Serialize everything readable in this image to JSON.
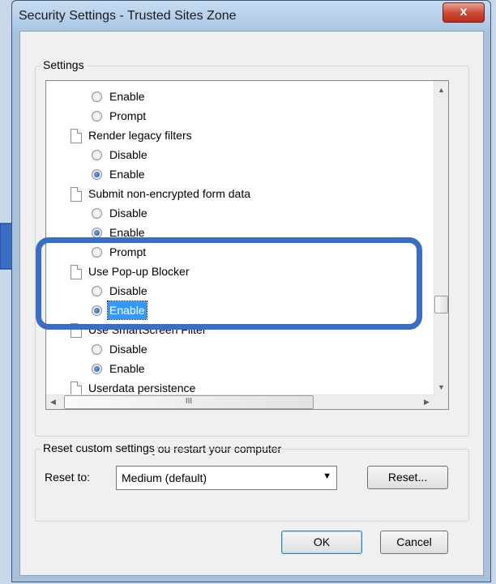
{
  "window": {
    "title": "Security Settings - Trusted Sites Zone",
    "close_label": "x"
  },
  "settings_group": {
    "label": "Settings",
    "rows": [
      {
        "kind": "radio",
        "label": "Enable",
        "checked": false
      },
      {
        "kind": "radio",
        "label": "Prompt",
        "checked": false
      },
      {
        "kind": "setting",
        "label": "Render legacy filters"
      },
      {
        "kind": "radio",
        "label": "Disable",
        "checked": false
      },
      {
        "kind": "radio",
        "label": "Enable",
        "checked": true
      },
      {
        "kind": "setting",
        "label": "Submit non-encrypted form data"
      },
      {
        "kind": "radio",
        "label": "Disable",
        "checked": false
      },
      {
        "kind": "radio",
        "label": "Enable",
        "checked": true
      },
      {
        "kind": "radio",
        "label": "Prompt",
        "checked": false
      },
      {
        "kind": "setting",
        "label": "Use Pop-up Blocker"
      },
      {
        "kind": "radio",
        "label": "Disable",
        "checked": false
      },
      {
        "kind": "radio",
        "label": "Enable",
        "checked": true,
        "selected": true
      },
      {
        "kind": "setting",
        "label": "Use SmartScreen Filter"
      },
      {
        "kind": "radio",
        "label": "Disable",
        "checked": false
      },
      {
        "kind": "radio",
        "label": "Enable",
        "checked": true
      },
      {
        "kind": "setting",
        "label": "Userdata persistence"
      }
    ],
    "hscroll_thumb_label": "III",
    "note": "*Takes effect after you restart your computer"
  },
  "reset_group": {
    "label": "Reset custom settings",
    "reset_to_label": "Reset to:",
    "reset_to_value": "Medium (default)",
    "reset_button": "Reset..."
  },
  "footer": {
    "ok_button": "OK",
    "cancel_button": "Cancel"
  },
  "annotation": {
    "highlight_color": "#3a6dc4",
    "pointer_color": "#3a6dc4"
  }
}
